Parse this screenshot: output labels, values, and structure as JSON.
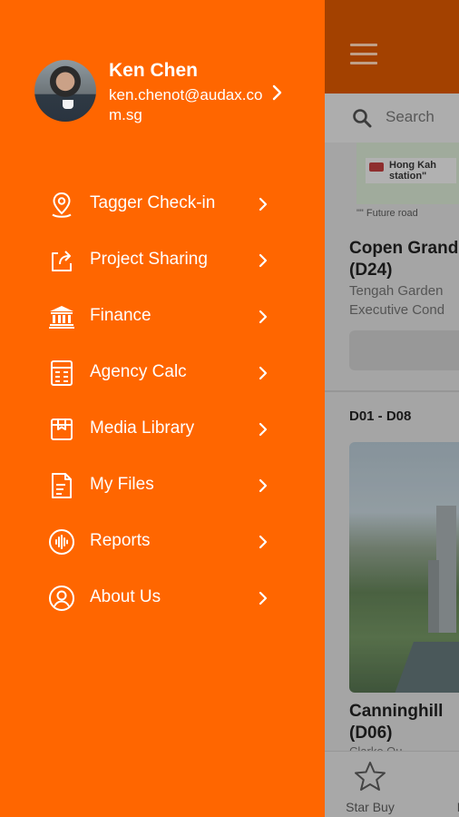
{
  "app": {
    "search_placeholder": "Search",
    "map_label": "Hong Kah station\"",
    "future_road": "\"\" Future road",
    "listing1": {
      "title_line1": "Copen Grand",
      "title_line2": "(D24)",
      "sub_line1": "Tengah Garden",
      "sub_line2": "Executive Cond"
    },
    "section_label": "D01 - D08",
    "listing2": {
      "title_line1": "Canninghill",
      "title_line2": "(D06)",
      "sub_line1": "Clarke Qu"
    },
    "bottom_tabs": [
      {
        "label": "Star Buy",
        "icon": "star-icon"
      },
      {
        "label": "F",
        "icon": "file-icon"
      }
    ]
  },
  "profile": {
    "name": "Ken Chen",
    "email": "ken.chenot@audax.com.sg"
  },
  "menu": [
    {
      "label": "Tagger Check-in",
      "icon": "location-pin-icon"
    },
    {
      "label": "Project Sharing",
      "icon": "share-icon"
    },
    {
      "label": "Finance",
      "icon": "bank-icon"
    },
    {
      "label": "Agency Calc",
      "icon": "calculator-icon"
    },
    {
      "label": "Media Library",
      "icon": "media-box-icon"
    },
    {
      "label": "My Files",
      "icon": "file-icon"
    },
    {
      "label": "Reports",
      "icon": "reports-icon"
    },
    {
      "label": "About Us",
      "icon": "user-circle-icon"
    }
  ],
  "colors": {
    "drawer": "#ff6600",
    "header": "#cc5200"
  }
}
